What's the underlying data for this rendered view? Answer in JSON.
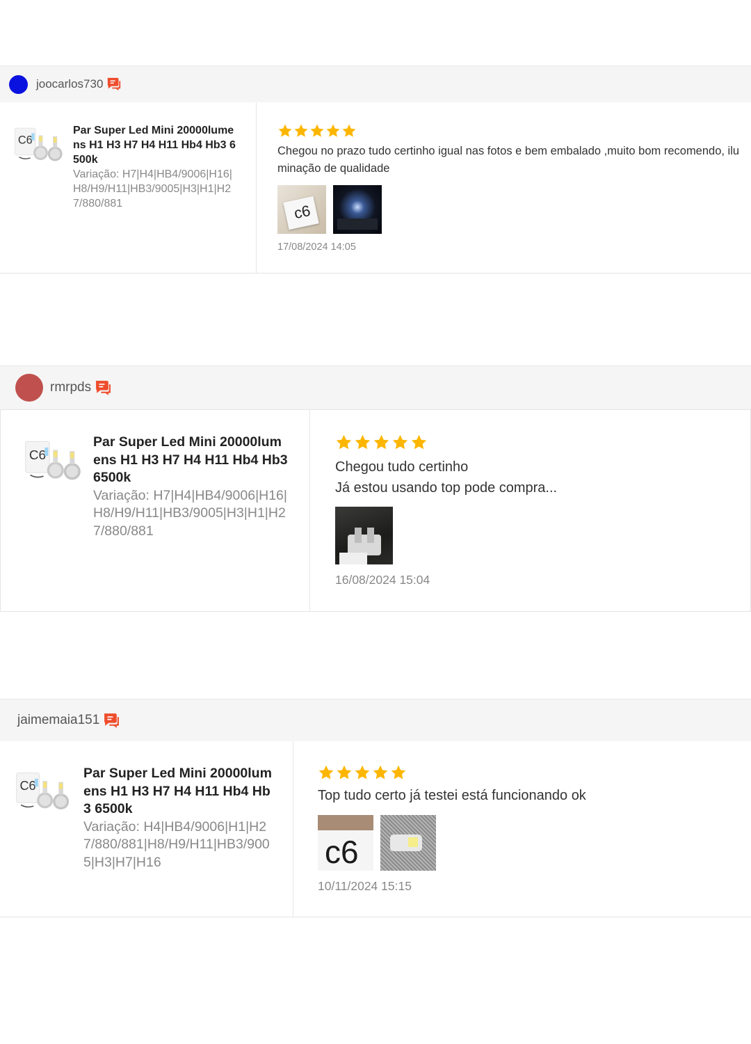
{
  "reviews": [
    {
      "username": "joocarlos730",
      "avatar_color": "#0a12e0",
      "chat_icon": "chat-bubbles-icon",
      "product": {
        "title": "Par Super Led Mini 20000lumens H1 H3 H7 H4 H11 Hb4 Hb3 6500k",
        "variation": "Variação: H7|H4|HB4/9006|H16|H8/H9/H11|HB3/9005|H3|H1|H27/880/881"
      },
      "rating": 5,
      "comment": "Chegou no prazo tudo certinho igual nas fotos e bem embalado ,muito bom recomendo, iluminação de qualidade",
      "date": "17/08/2024 14:05",
      "photo_count": 2
    },
    {
      "username": "rmrpds",
      "avatar_color": "#c0504d",
      "chat_icon": "chat-bubbles-icon",
      "product": {
        "title": "Par Super Led Mini 20000lumens H1 H3 H7 H4 H11 Hb4 Hb3 6500k",
        "variation": "Variação: H7|H4|HB4/9006|H16|H8/H9/H11|HB3/9005|H3|H1|H27/880/881"
      },
      "rating": 5,
      "comment_lines": [
        "Chegou tudo certinho",
        "Já estou usando top pode compra..."
      ],
      "date": "16/08/2024 15:04",
      "photo_count": 1
    },
    {
      "username": "jaimemaia151",
      "chat_icon": "chat-bubbles-icon",
      "product": {
        "title": "Par Super Led Mini 20000lumens H1 H3 H7 H4 H11 Hb4 Hb3 6500k",
        "variation": "Variação: H4|HB4/9006|H1|H27/880/881|H8/H9/H11|HB3/9005|H3|H7|H16"
      },
      "rating": 5,
      "comment": "Top tudo certo já testei está funcionando ok",
      "date": "10/11/2024 15:15",
      "photo_count": 2
    }
  ],
  "colors": {
    "star": "#fdb600",
    "chat_icon": "#ee4d2d",
    "header_bg": "#f5f5f5"
  }
}
